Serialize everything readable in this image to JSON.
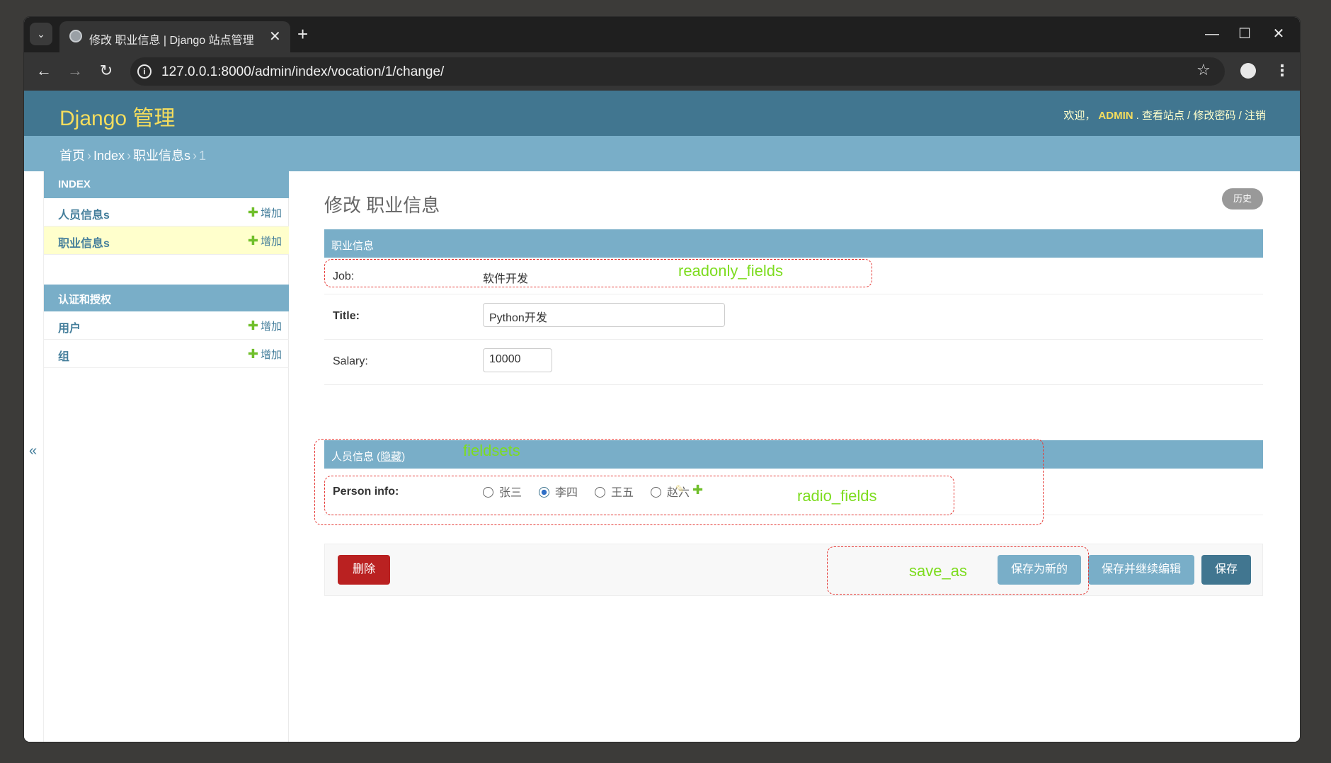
{
  "browser": {
    "tab_title": "修改 职业信息 | Django 站点管理",
    "url": "127.0.0.1:8000/admin/index/vocation/1/change/"
  },
  "header": {
    "brand": "Django 管理",
    "welcome": "欢迎，",
    "user": "ADMIN",
    "view_site": "查看站点",
    "change_password": "修改密码",
    "logout": "注销",
    "sep1": ". ",
    "sep2": " / "
  },
  "breadcrumbs": {
    "home": "首页",
    "app": "Index",
    "model": "职业信息s",
    "current": "1",
    "sep": "›"
  },
  "sidebar": {
    "toggle": "«",
    "modules": [
      {
        "caption": "INDEX",
        "items": [
          {
            "label": "人员信息s",
            "add": "增加"
          },
          {
            "label": "职业信息s",
            "add": "增加"
          }
        ]
      },
      {
        "caption": "认证和授权",
        "items": [
          {
            "label": "用户",
            "add": "增加"
          },
          {
            "label": "组",
            "add": "增加"
          }
        ]
      }
    ]
  },
  "main": {
    "title": "修改 职业信息",
    "history": "历史",
    "fieldset1": {
      "caption": "职业信息",
      "job_label": "Job:",
      "job_value": "软件开发",
      "title_label": "Title:",
      "title_value": "Python开发",
      "salary_label": "Salary:",
      "salary_value": "10000"
    },
    "fieldset2": {
      "caption": "人员信息",
      "toggle": "隐藏",
      "person_label": "Person info:",
      "options": [
        "张三",
        "李四",
        "王五",
        "赵六"
      ],
      "selected": "李四"
    },
    "buttons": {
      "delete": "删除",
      "save_as_new": "保存为新的",
      "save_continue": "保存并继续编辑",
      "save": "保存"
    }
  },
  "annotations": {
    "readonly": "readonly_fields",
    "fieldsets": "fieldsets",
    "radio": "radio_fields",
    "save_as": "save_as"
  },
  "colors": {
    "header": "#417690",
    "caption": "#79aec8",
    "brand": "#f5dd5d",
    "delete": "#ba2121",
    "annotation": "#7ddc1f",
    "annotation_border": "#e53935"
  }
}
